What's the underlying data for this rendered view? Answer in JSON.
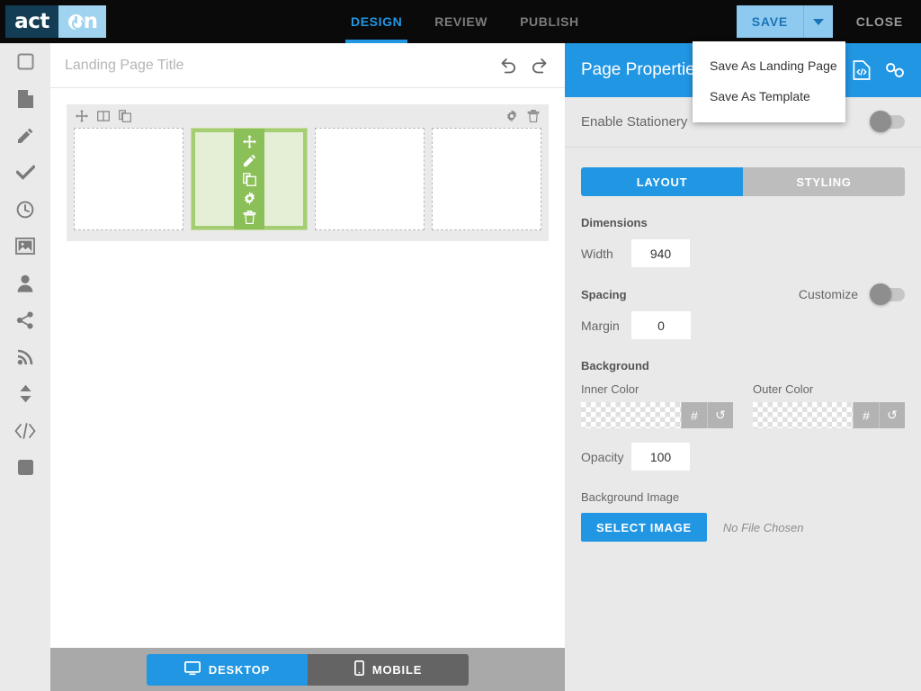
{
  "topbar": {
    "logo": {
      "left_text": "act",
      "right_text": "n",
      "separator": "-"
    },
    "nav": [
      {
        "label": "DESIGN",
        "active": true
      },
      {
        "label": "REVIEW",
        "active": false
      },
      {
        "label": "PUBLISH",
        "active": false
      }
    ],
    "save_label": "SAVE",
    "close_label": "CLOSE"
  },
  "save_dropdown": {
    "open": true,
    "items": [
      {
        "label": "Save As Landing Page"
      },
      {
        "label": "Save As Template"
      }
    ]
  },
  "rail": {
    "items": [
      {
        "name": "square-outline-icon"
      },
      {
        "name": "page-icon"
      },
      {
        "name": "pencil-icon"
      },
      {
        "name": "check-icon"
      },
      {
        "name": "clock-icon"
      },
      {
        "name": "image-icon"
      },
      {
        "name": "person-icon"
      },
      {
        "name": "share-icon"
      },
      {
        "name": "rss-icon"
      },
      {
        "name": "updown-arrows-icon"
      },
      {
        "name": "code-icon"
      },
      {
        "name": "square-filled-icon"
      }
    ]
  },
  "canvas": {
    "title_placeholder": "Landing Page Title",
    "title_value": "",
    "row_toolbar_left": [
      "move-icon",
      "columns-icon",
      "duplicate-icon"
    ],
    "row_toolbar_right": [
      "gear-icon",
      "trash-icon"
    ],
    "cells": [
      {
        "selected": false
      },
      {
        "selected": true
      },
      {
        "selected": false
      },
      {
        "selected": false
      }
    ],
    "cell_tools": [
      "move-icon",
      "pencil-icon",
      "duplicate-icon",
      "gear-icon",
      "trash-icon"
    ]
  },
  "device_bar": {
    "desktop_label": "DESKTOP",
    "mobile_label": "MOBILE",
    "active": "DESKTOP"
  },
  "panel": {
    "title": "Page Properties",
    "header_icons": [
      "html-code-icon",
      "link-icon"
    ],
    "stationery_label": "Enable Stationery",
    "stationery_on": false,
    "tabs": [
      {
        "label": "LAYOUT",
        "active": true
      },
      {
        "label": "STYLING",
        "active": false
      }
    ],
    "dimensions": {
      "heading": "Dimensions",
      "width_label": "Width",
      "width_value": "940"
    },
    "spacing": {
      "heading": "Spacing",
      "customize_label": "Customize",
      "customize_on": false,
      "margin_label": "Margin",
      "margin_value": "0"
    },
    "background": {
      "heading": "Background",
      "inner_color_label": "Inner Color",
      "outer_color_label": "Outer Color",
      "hash_label": "#",
      "reset_label": "↺",
      "opacity_label": "Opacity",
      "opacity_value": "100",
      "bgimage_label": "Background Image",
      "select_image_label": "SELECT IMAGE",
      "no_file_label": "No File Chosen"
    }
  },
  "colors": {
    "brand_blue": "#2196e3",
    "topbar_black": "#0a0a0a",
    "save_light_blue": "#8ecaf0",
    "panel_gray": "#e9e9e9",
    "cell_green": "#a5ce72",
    "cell_tools_green": "#8bbf58"
  }
}
